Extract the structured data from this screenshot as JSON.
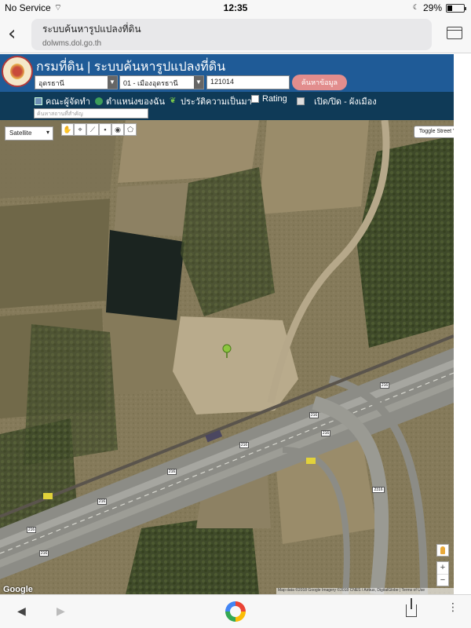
{
  "status_bar": {
    "carrier": "No Service",
    "time": "12:35",
    "battery": "29%",
    "battery_level": 0.29
  },
  "browser": {
    "page_title": "ระบบค้นหารูปแปลงที่ดิน",
    "url": "dolwms.dol.go.th"
  },
  "site": {
    "title": "กรมที่ดิน | ระบบค้นหารูปแปลงที่ดิน",
    "province_select": "อุดรธานี",
    "district_select": "01 - เมืองอุดรธานี",
    "parcel_number": "121014",
    "search_button": "ค้นหาข้อมูล",
    "location_search_placeholder": "ค้นหาสถานที่สำคัญ"
  },
  "menu": {
    "items": [
      {
        "label": "คณะผู้จัดทำ",
        "icon": "book-icon"
      },
      {
        "label": "ตำแหน่งของฉัน",
        "icon": "globe-icon"
      },
      {
        "label": "ประวัติความเป็นมา",
        "icon": "leaf-icon"
      },
      {
        "label": "Rating",
        "icon": "chart-icon"
      },
      {
        "label": "เปิด/ปิด - ผังเมือง",
        "icon": "checkbox-icon"
      }
    ]
  },
  "map": {
    "map_type": "Satellite",
    "street_view_button": "Toggle Street View",
    "logo": "Google",
    "attribution": "Map data ©2018 Google Imagery ©2018 CNES / Airbus, DigitalGlobe | Terms of Use",
    "road_shields": [
      "216",
      "216",
      "216",
      "216",
      "216",
      "216",
      "216",
      "216",
      "2316"
    ],
    "zoom_in": "+",
    "zoom_out": "−"
  },
  "toolbar": {
    "back": "◀",
    "forward": "▶",
    "more": "⋮"
  }
}
